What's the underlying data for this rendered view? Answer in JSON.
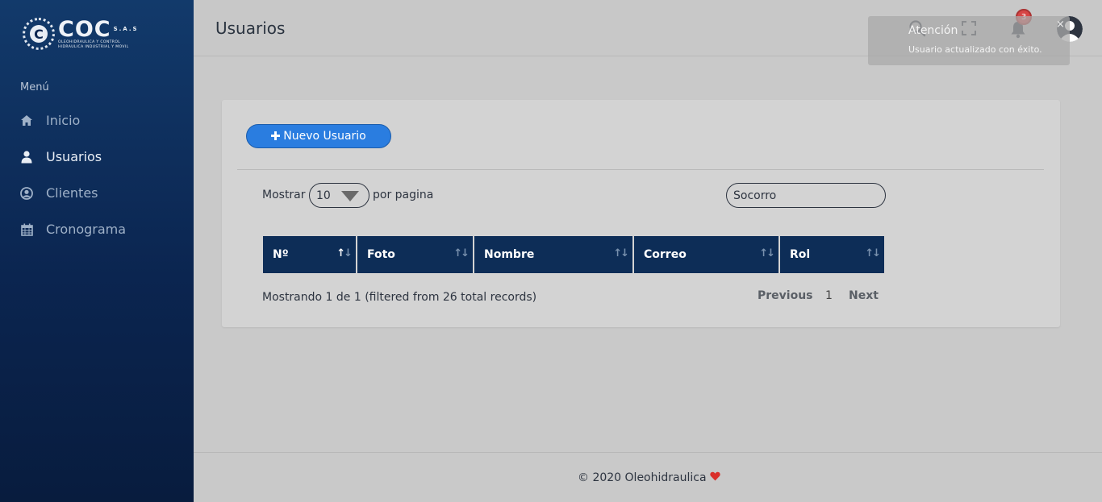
{
  "brand": {
    "name": "COC",
    "suffix": "S.A.S",
    "tagline": "OLEOHIDRAULICA Y CONTROL",
    "tagline2": "HIDRAULICA INDUSTRIAL Y MOVIL",
    "mark": "C"
  },
  "sidebar": {
    "header": "Menú",
    "items": [
      {
        "label": "Inicio",
        "icon": "home-icon"
      },
      {
        "label": "Usuarios",
        "icon": "user-icon"
      },
      {
        "label": "Clientes",
        "icon": "user-circle-icon"
      },
      {
        "label": "Cronograma",
        "icon": "calendar-icon"
      }
    ]
  },
  "header": {
    "title": "Usuarios",
    "notification_count": "3"
  },
  "toast": {
    "title": "Atención",
    "message": "Usuario actualizado con éxito.",
    "close": "×"
  },
  "actions": {
    "new_user": "Nuevo Usuario"
  },
  "controls": {
    "show_label": "Mostrar",
    "page_length": "10",
    "per_page_label": "por pagina",
    "search_value": "Socorro"
  },
  "table": {
    "columns": [
      "Nº",
      "Foto",
      "Nombre",
      "Correo",
      "Rol"
    ]
  },
  "info": "Mostrando 1 de 1 (filtered from 26 total records)",
  "pagination": {
    "previous": "Previous",
    "page": "1",
    "next": "Next"
  },
  "footer": {
    "text": "© 2020 Oleohidraulica"
  },
  "colors": {
    "sidebar": "#0b2550",
    "accent": "#2a7de0",
    "table_header": "#0d2d57",
    "badge": "#d64545"
  }
}
